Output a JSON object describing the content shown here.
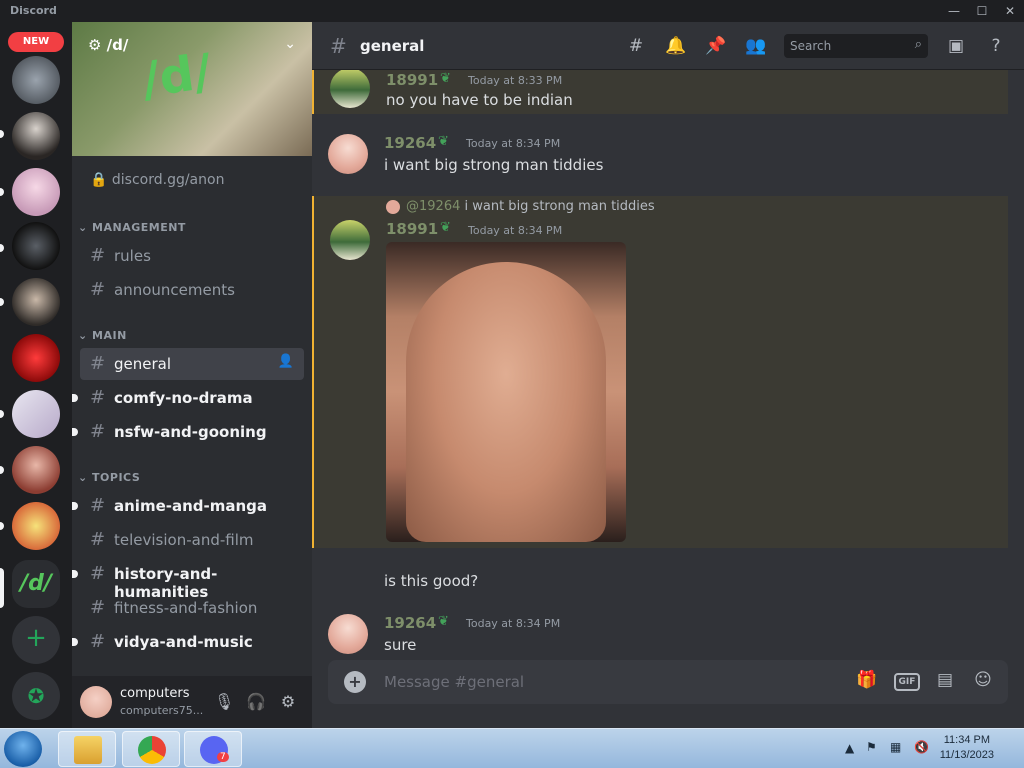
{
  "window": {
    "app_title": "Discord",
    "minimize": "—",
    "maximize": "☐",
    "close": "✕"
  },
  "rail": {
    "new_badge": "NEW",
    "active_server_label": "/d/",
    "add_label": "+",
    "explore_icon": "compass"
  },
  "sidebar": {
    "server_name": "/d/",
    "banner_text": "/d/",
    "invite": "discord.gg/anon",
    "categories": {
      "management": "MANAGEMENT",
      "main": "MAIN",
      "topics": "TOPICS"
    },
    "channels": {
      "rules": "rules",
      "announcements": "announcements",
      "general": "general",
      "comfy": "comfy-no-drama",
      "nsfw": "nsfw-and-gooning",
      "anime": "anime-and-manga",
      "tv": "television-and-film",
      "history": "history-and-humanities",
      "fitness": "fitness-and-fashion",
      "vidya": "vidya-and-music"
    }
  },
  "user": {
    "name": "computers",
    "tag": "computers75..."
  },
  "header": {
    "channel": "general",
    "search_placeholder": "Search"
  },
  "messages": [
    {
      "author": "18991",
      "time": "Today at 8:33 PM",
      "text": "no you have to be indian"
    },
    {
      "author": "19264",
      "time": "Today at 8:34 PM",
      "text": "i want big strong man tiddies"
    },
    {
      "reply_to": "@19264",
      "reply_text": "i want big strong man tiddies",
      "author": "18991",
      "time": "Today at 8:34 PM",
      "text": "is this good?"
    },
    {
      "author": "19264",
      "time": "Today at 8:34 PM",
      "text": "sure"
    }
  ],
  "composer": {
    "placeholder": "Message #general",
    "gif_label": "GIF"
  },
  "taskbar": {
    "time": "11:34 PM",
    "date": "11/13/2023",
    "discord_badge": "7"
  }
}
